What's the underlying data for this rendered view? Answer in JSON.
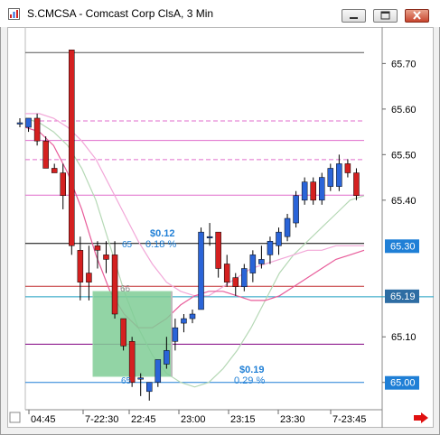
{
  "window": {
    "title": "S.CMCSA - Comcast Corp ClsA, 3 Min",
    "minimize_icon": "minimize-icon",
    "restore_icon": "restore-icon",
    "close_icon": "close-icon"
  },
  "colors": {
    "up": "#2a64d8",
    "down": "#d42020",
    "axis_label_bg": "#1f7fd6",
    "trade_box": "#7fcd95"
  },
  "annotations": {
    "upper_price": "$0.12",
    "upper_pct": "0.18 %",
    "upper_qty": "65",
    "lower_price": "$0.19",
    "lower_pct": "0.29 %",
    "lower_qty": "65",
    "box_qty": "66"
  },
  "scroll_arrow_icon": "arrow-right-icon",
  "chart_data": {
    "type": "candlestick",
    "ylim": [
      64.94,
      65.78
    ],
    "yticks": [
      "65.70",
      "65.60",
      "65.50",
      "65.40",
      "65.10",
      "65.00"
    ],
    "price_badges": [
      {
        "label": "65.30",
        "value": 65.3,
        "color": "#1f7fd6"
      },
      {
        "label": "65.19",
        "value": 65.19,
        "color": "#2e6da3"
      },
      {
        "label": "65.00",
        "value": 65.0,
        "color": "#1f7fd6"
      }
    ],
    "x_tick_labels": [
      "04:45",
      "7-22:30",
      "22:45",
      "23:00",
      "23:15",
      "23:30",
      "7-23:45"
    ],
    "levels": [
      {
        "value": 65.724,
        "color": "#555555",
        "style": "solid"
      },
      {
        "value": 65.574,
        "color": "#e06ccc",
        "style": "dashed"
      },
      {
        "value": 65.531,
        "color": "#e06ccc",
        "style": "solid"
      },
      {
        "value": 65.489,
        "color": "#e06ccc",
        "style": "dashed"
      },
      {
        "value": 65.411,
        "color": "#e06ccc",
        "style": "solid"
      },
      {
        "value": 65.305,
        "color": "#000000",
        "style": "solid"
      },
      {
        "value": 65.211,
        "color": "#c0292a",
        "style": "solid"
      },
      {
        "value": 65.188,
        "color": "#1f9fc0",
        "style": "solid"
      },
      {
        "value": 65.084,
        "color": "#800080",
        "style": "solid"
      },
      {
        "value": 65.0,
        "color": "#1f7fd6",
        "style": "solid"
      }
    ],
    "candles": [
      {
        "o": 65.57,
        "h": 65.58,
        "l": 65.56,
        "c": 65.57
      },
      {
        "o": 65.56,
        "h": 65.58,
        "l": 65.55,
        "c": 65.58
      },
      {
        "o": 65.58,
        "h": 65.59,
        "l": 65.52,
        "c": 65.53
      },
      {
        "o": 65.53,
        "h": 65.54,
        "l": 65.47,
        "c": 65.47
      },
      {
        "o": 65.47,
        "h": 65.48,
        "l": 65.46,
        "c": 65.46
      },
      {
        "o": 65.46,
        "h": 65.48,
        "l": 65.38,
        "c": 65.41
      },
      {
        "o": 65.73,
        "h": 65.73,
        "l": 65.28,
        "c": 65.3
      },
      {
        "o": 65.29,
        "h": 65.32,
        "l": 65.18,
        "c": 65.22
      },
      {
        "o": 65.24,
        "h": 65.3,
        "l": 65.18,
        "c": 65.22
      },
      {
        "o": 65.3,
        "h": 65.31,
        "l": 65.25,
        "c": 65.29
      },
      {
        "o": 65.28,
        "h": 65.31,
        "l": 65.24,
        "c": 65.27
      },
      {
        "o": 65.28,
        "h": 65.31,
        "l": 65.14,
        "c": 65.15
      },
      {
        "o": 65.14,
        "h": 65.14,
        "l": 65.07,
        "c": 65.08
      },
      {
        "o": 65.09,
        "h": 65.1,
        "l": 64.99,
        "c": 65.0
      },
      {
        "o": 65.01,
        "h": 65.02,
        "l": 64.97,
        "c": 65.01
      },
      {
        "o": 64.98,
        "h": 65.0,
        "l": 64.96,
        "c": 65.0
      },
      {
        "o": 65.0,
        "h": 65.05,
        "l": 64.99,
        "c": 65.05
      },
      {
        "o": 65.04,
        "h": 65.1,
        "l": 65.03,
        "c": 65.07
      },
      {
        "o": 65.09,
        "h": 65.14,
        "l": 65.07,
        "c": 65.12
      },
      {
        "o": 65.13,
        "h": 65.15,
        "l": 65.11,
        "c": 65.14
      },
      {
        "o": 65.14,
        "h": 65.16,
        "l": 65.13,
        "c": 65.15
      },
      {
        "o": 65.16,
        "h": 65.34,
        "l": 65.16,
        "c": 65.33
      },
      {
        "o": 65.32,
        "h": 65.35,
        "l": 65.3,
        "c": 65.32
      },
      {
        "o": 65.33,
        "h": 65.33,
        "l": 65.23,
        "c": 65.25
      },
      {
        "o": 65.26,
        "h": 65.28,
        "l": 65.21,
        "c": 65.22
      },
      {
        "o": 65.23,
        "h": 65.24,
        "l": 65.19,
        "c": 65.21
      },
      {
        "o": 65.21,
        "h": 65.26,
        "l": 65.2,
        "c": 65.25
      },
      {
        "o": 65.24,
        "h": 65.29,
        "l": 65.22,
        "c": 65.28
      },
      {
        "o": 65.26,
        "h": 65.3,
        "l": 65.25,
        "c": 65.27
      },
      {
        "o": 65.28,
        "h": 65.32,
        "l": 65.26,
        "c": 65.31
      },
      {
        "o": 65.3,
        "h": 65.34,
        "l": 65.28,
        "c": 65.33
      },
      {
        "o": 65.32,
        "h": 65.37,
        "l": 65.31,
        "c": 65.36
      },
      {
        "o": 65.35,
        "h": 65.42,
        "l": 65.34,
        "c": 65.41
      },
      {
        "o": 65.4,
        "h": 65.45,
        "l": 65.39,
        "c": 65.44
      },
      {
        "o": 65.44,
        "h": 65.45,
        "l": 65.39,
        "c": 65.4
      },
      {
        "o": 65.4,
        "h": 65.46,
        "l": 65.39,
        "c": 65.45
      },
      {
        "o": 65.43,
        "h": 65.48,
        "l": 65.42,
        "c": 65.47
      },
      {
        "o": 65.43,
        "h": 65.5,
        "l": 65.42,
        "c": 65.48
      },
      {
        "o": 65.48,
        "h": 65.49,
        "l": 65.45,
        "c": 65.46
      },
      {
        "o": 65.46,
        "h": 65.47,
        "l": 65.4,
        "c": 65.41
      }
    ],
    "bands": [
      {
        "color": "#b5d8b5",
        "values": [
          65.58,
          65.57,
          65.55,
          65.52,
          65.47,
          65.4,
          65.3,
          65.2,
          65.12,
          65.06,
          65.02,
          65.0,
          64.99,
          65.0,
          65.03,
          65.07,
          65.12,
          65.18,
          65.24,
          65.28,
          65.31,
          65.34,
          65.37,
          65.4,
          65.41
        ]
      },
      {
        "color": "#f2a7d8",
        "values": [
          65.59,
          65.59,
          65.58,
          65.56,
          65.53,
          65.49,
          65.43,
          65.37,
          65.31,
          65.26,
          65.22,
          65.2,
          65.19,
          65.19,
          65.21,
          65.23,
          65.25,
          65.26,
          65.27,
          65.28,
          65.29,
          65.29,
          65.3,
          65.3,
          65.3
        ]
      },
      {
        "color": "#e85c9a",
        "values": [
          65.56,
          65.55,
          65.52,
          65.46,
          65.38,
          65.28,
          65.2,
          65.15,
          65.12,
          65.12,
          65.14,
          65.17,
          65.19,
          65.2,
          65.2,
          65.19,
          65.18,
          65.18,
          65.19,
          65.21,
          65.23,
          65.25,
          65.27,
          65.28,
          65.29
        ]
      }
    ]
  }
}
